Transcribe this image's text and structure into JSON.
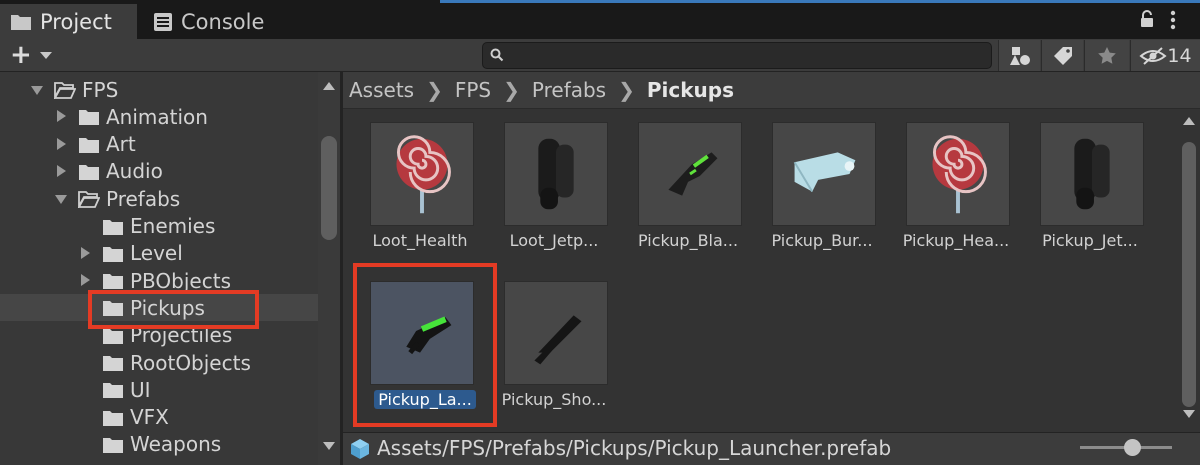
{
  "tabs": [
    {
      "label": "Project",
      "active": true
    },
    {
      "label": "Console",
      "active": false
    }
  ],
  "toolbar": {
    "add_label": "+",
    "search_value": "",
    "hidden_count": "14"
  },
  "tree": [
    {
      "label": "FPS",
      "level": 0,
      "expanded": true,
      "selected": false
    },
    {
      "label": "Animation",
      "level": 1,
      "expanded": false,
      "selected": false
    },
    {
      "label": "Art",
      "level": 1,
      "expanded": false,
      "selected": false
    },
    {
      "label": "Audio",
      "level": 1,
      "expanded": false,
      "selected": false
    },
    {
      "label": "Prefabs",
      "level": 1,
      "expanded": true,
      "selected": false
    },
    {
      "label": "Enemies",
      "level": 2,
      "expanded": null,
      "selected": false
    },
    {
      "label": "Level",
      "level": 2,
      "expanded": false,
      "selected": false
    },
    {
      "label": "PBObjects",
      "level": 2,
      "expanded": false,
      "selected": false
    },
    {
      "label": "Pickups",
      "level": 2,
      "expanded": null,
      "selected": true
    },
    {
      "label": "Projectiles",
      "level": 2,
      "expanded": null,
      "selected": false
    },
    {
      "label": "RootObjects",
      "level": 2,
      "expanded": null,
      "selected": false
    },
    {
      "label": "UI",
      "level": 2,
      "expanded": null,
      "selected": false
    },
    {
      "label": "VFX",
      "level": 2,
      "expanded": null,
      "selected": false
    },
    {
      "label": "Weapons",
      "level": 2,
      "expanded": null,
      "selected": false
    }
  ],
  "breadcrumb": [
    "Assets",
    "FPS",
    "Prefabs",
    "Pickups"
  ],
  "assets": [
    {
      "name": "Loot_Health",
      "icon": "lollipop-icon"
    },
    {
      "name": "Loot_Jetp...",
      "icon": "jetpack-icon"
    },
    {
      "name": "Pickup_Bla...",
      "icon": "blaster-icon"
    },
    {
      "name": "Pickup_Bur...",
      "icon": "burst-gun-icon"
    },
    {
      "name": "Pickup_Hea...",
      "icon": "lollipop-icon"
    },
    {
      "name": "Pickup_Jet...",
      "icon": "jetpack-icon"
    },
    {
      "name": "Pickup_La...",
      "icon": "launcher-icon",
      "selected": true
    },
    {
      "name": "Pickup_Sho...",
      "icon": "shotgun-icon"
    }
  ],
  "status": {
    "path": "Assets/FPS/Prefabs/Pickups/Pickup_Launcher.prefab"
  },
  "colors": {
    "highlight": "#e43b24",
    "selection": "#2d5a8e",
    "accent": "#3a79bb"
  }
}
